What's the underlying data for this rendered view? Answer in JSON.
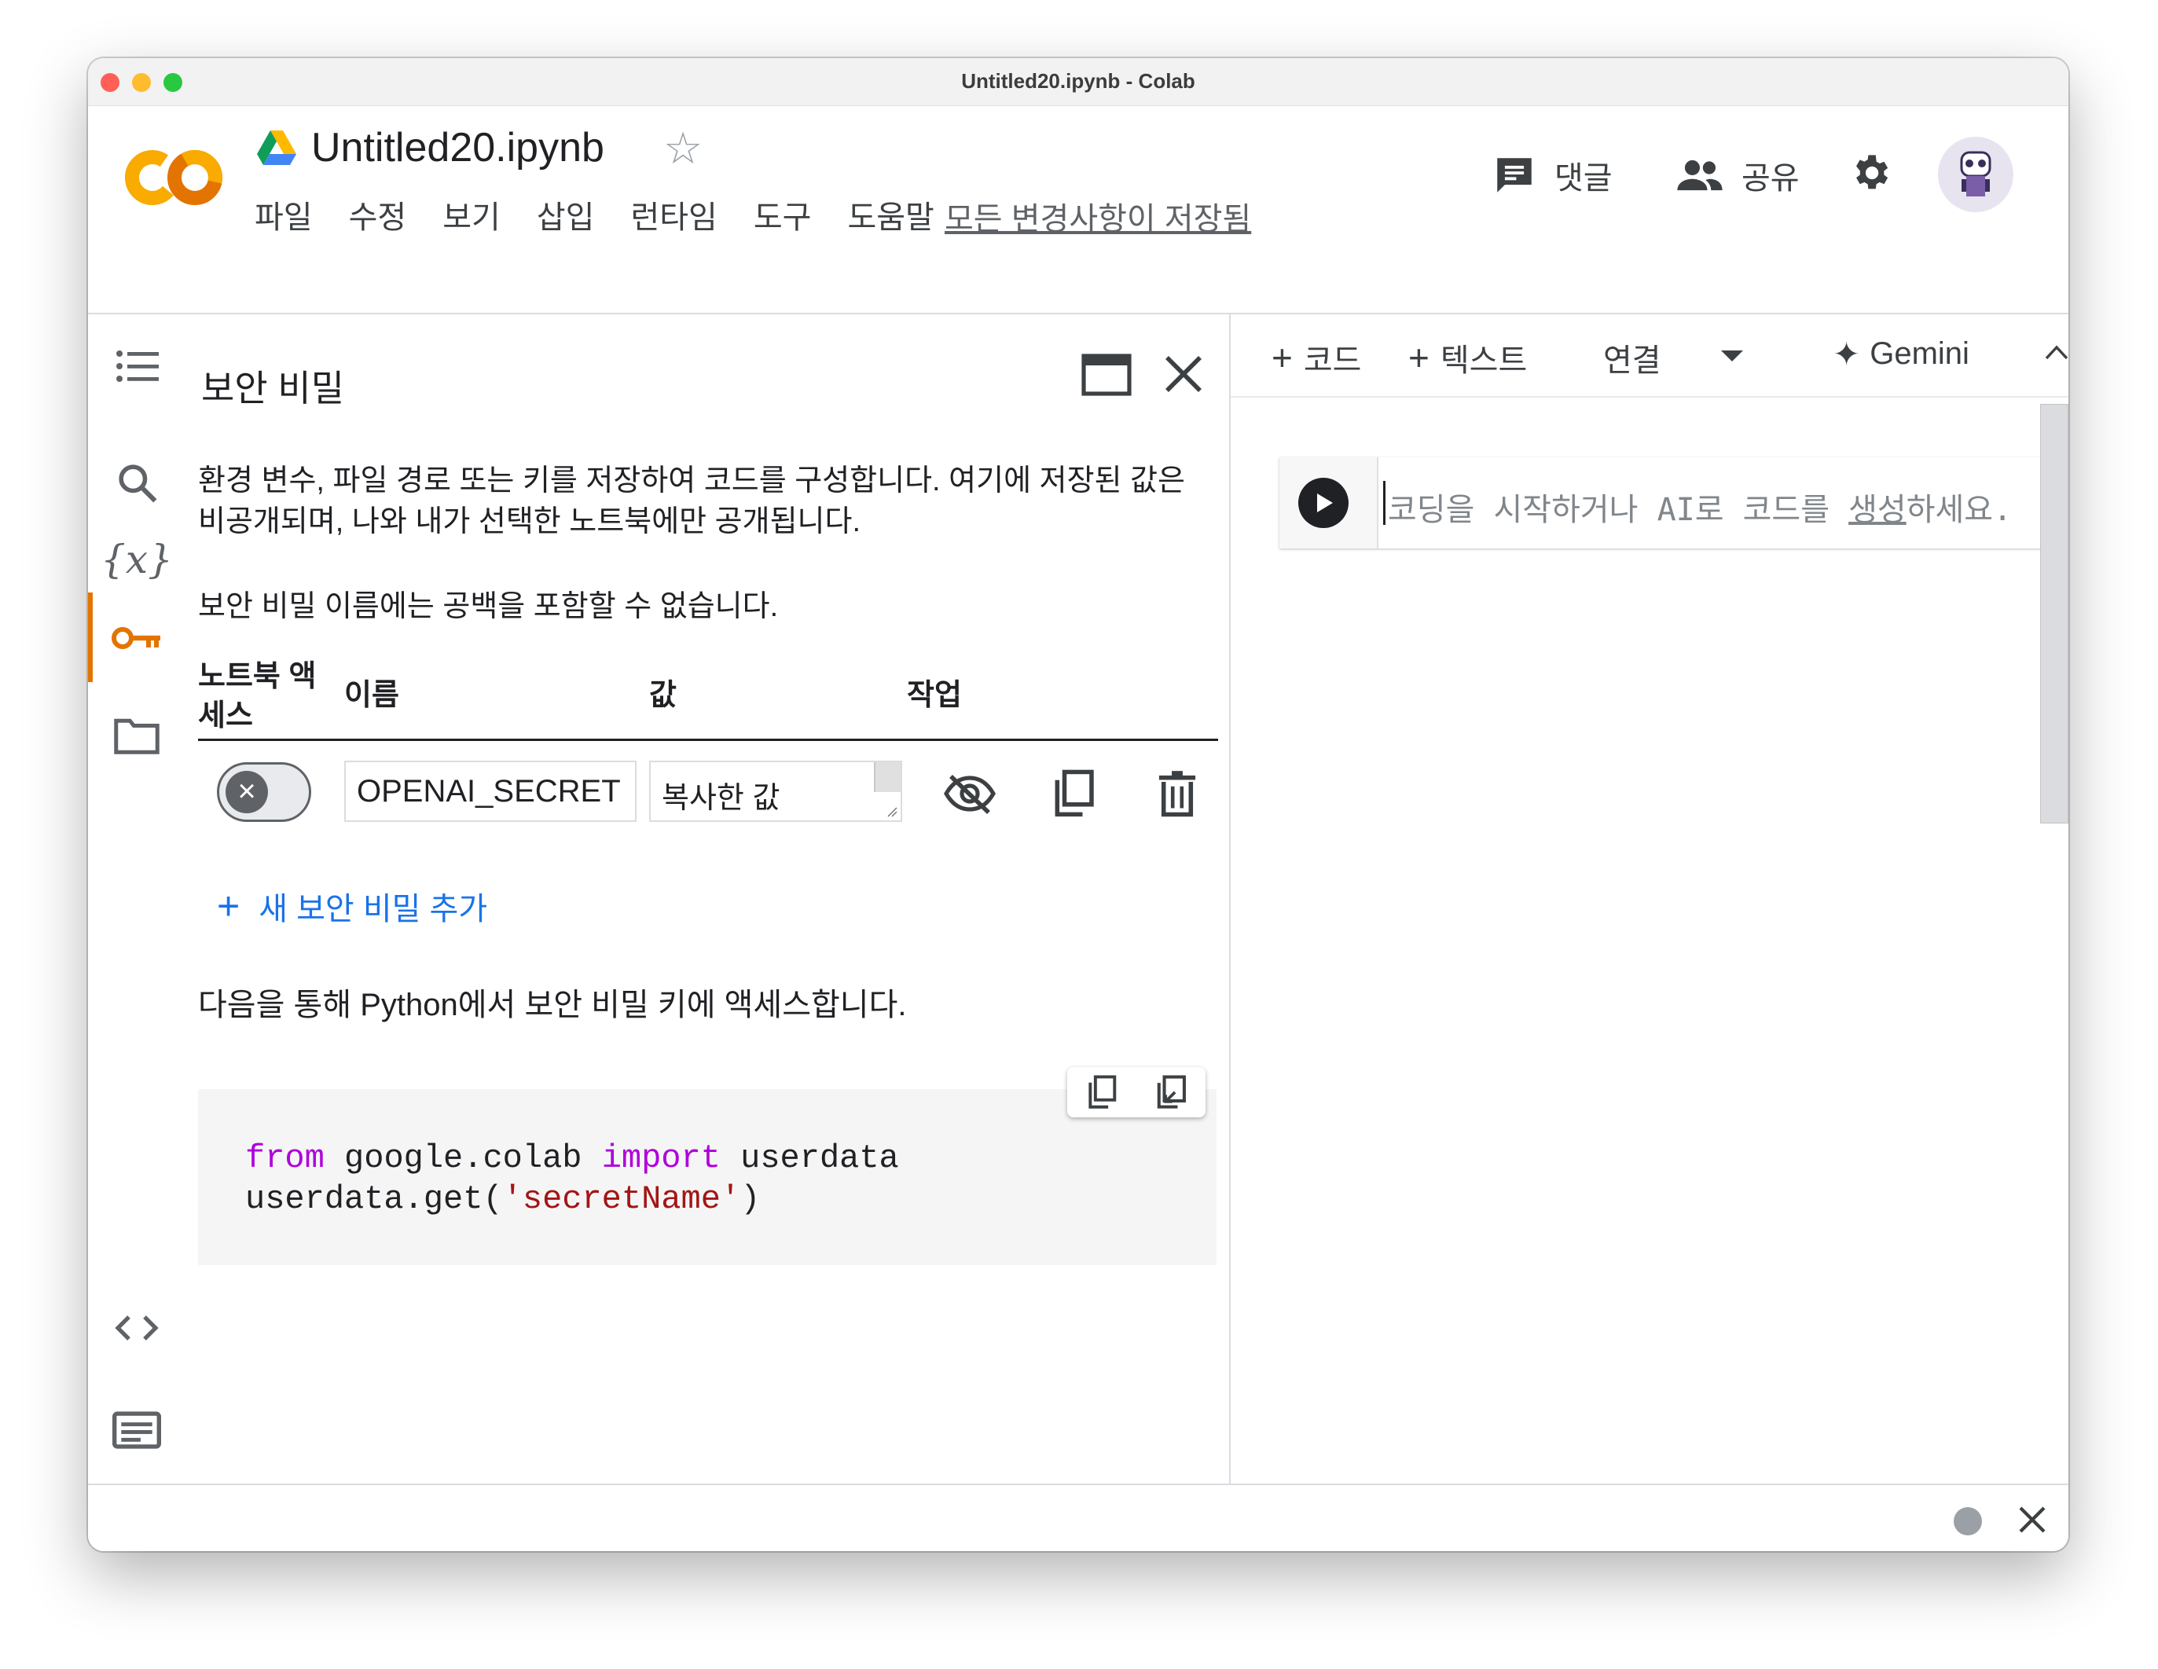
{
  "window": {
    "title": "Untitled20.ipynb - Colab"
  },
  "header": {
    "notebook_title": "Untitled20.ipynb",
    "menu": [
      "파일",
      "수정",
      "보기",
      "삽입",
      "런타임",
      "도구",
      "도움말"
    ],
    "saved_status": "모든 변경사항이 저장됨",
    "comment_label": "댓글",
    "share_label": "공유"
  },
  "sidebar": {
    "items": [
      "table-of-contents-icon",
      "search-icon",
      "variables-icon",
      "key-icon",
      "folder-icon",
      "code-snippets-icon",
      "command-palette-icon"
    ],
    "active": "key-icon"
  },
  "secrets": {
    "title": "보안 비밀",
    "description": "환경 변수, 파일 경로 또는 키를 저장하여 코드를 구성합니다. 여기에 저장된 값은 비공개되며, 나와 내가 선택한 노트북에만 공개됩니다.",
    "note": "보안 비밀 이름에는 공백을 포함할 수 없습니다.",
    "columns": {
      "access": "노트북 액세스",
      "name": "이름",
      "value": "값",
      "actions": "작업"
    },
    "rows": [
      {
        "access_enabled": false,
        "name": "OPENAI_SECRET",
        "value": "복사한 값"
      }
    ],
    "add_label": "새 보안 비밀 추가",
    "access_hint": "다음을 통해 Python에서 보안 비밀 키에 액세스합니다.",
    "code": {
      "line1_kw1": "from",
      "line1_mod": " google.colab ",
      "line1_kw2": "import",
      "line1_name": " userdata",
      "line2_call": "userdata.get(",
      "line2_str": "'secretName'",
      "line2_end": ")"
    }
  },
  "notebook": {
    "toolbar": {
      "add_code": "코드",
      "add_text": "텍스트",
      "connect": "연결",
      "gemini": "Gemini"
    },
    "cell_placeholder_start": "코딩을 시작하거나 AI로 코드를 ",
    "cell_placeholder_link": "생성",
    "cell_placeholder_end": "하세요."
  },
  "colors": {
    "accent": "#e37400",
    "link": "#1a73e8",
    "keyword": "#af00db",
    "string": "#a31515"
  }
}
